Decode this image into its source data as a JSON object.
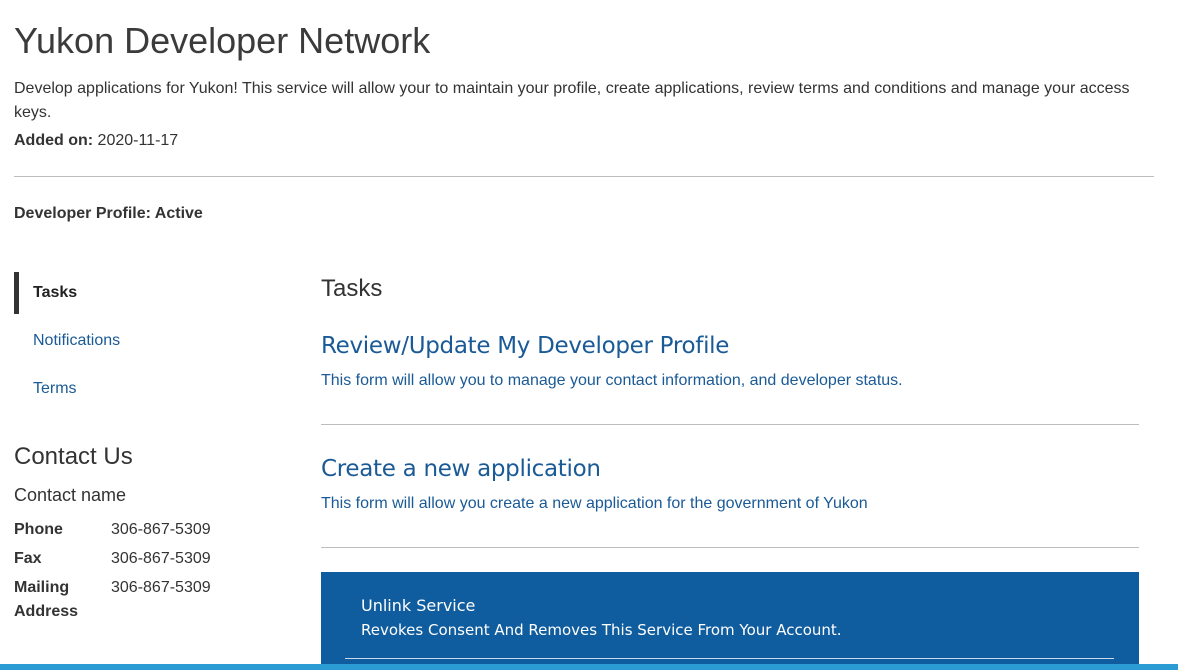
{
  "header": {
    "title": "Yukon Developer Network",
    "description": "Develop applications for Yukon! This service will allow your to maintain your profile, create applications, review terms and conditions and manage your access keys.",
    "added_label": "Added on:",
    "added_value": "2020-11-17",
    "profile_status": "Developer Profile: Active"
  },
  "sidebar": {
    "items": [
      {
        "label": "Tasks",
        "active": true
      },
      {
        "label": "Notifications",
        "active": false
      },
      {
        "label": "Terms",
        "active": false
      }
    ]
  },
  "contact": {
    "heading": "Contact Us",
    "name": "Contact name",
    "rows": [
      {
        "label": "Phone",
        "value": "306-867-5309"
      },
      {
        "label": "Fax",
        "value": "306-867-5309"
      },
      {
        "label": "Mailing Address",
        "value": "306-867-5309"
      }
    ]
  },
  "main": {
    "heading": "Tasks",
    "tasks": [
      {
        "title": "Review/Update My Developer Profile",
        "description": "This form will allow you to manage your contact information, and developer status."
      },
      {
        "title": "Create a new application",
        "description": "This form will allow you create a new application for the government of Yukon"
      }
    ],
    "unlink": {
      "title": "Unlink Service",
      "description": "Revokes Consent And Removes This Service From Your Account."
    }
  },
  "colors": {
    "link": "#1a5a96",
    "unlink_background": "#0f5c9e",
    "bottom_bar": "#2b9bd3"
  }
}
